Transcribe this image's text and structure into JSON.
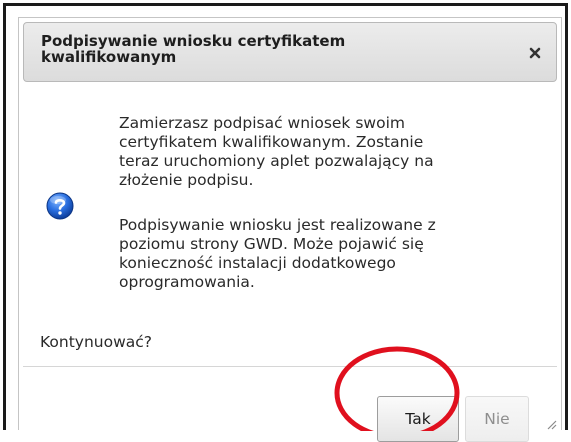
{
  "dialog": {
    "title": "Podpisywanie wniosku certyfikatem kwalifikowanym",
    "close_icon": "close-icon",
    "question_icon": "question-icon",
    "paragraph_1": "Zamierzasz podpisać wniosek swoim\ncertyfikatem kwalifikowanym. Zostanie\nteraz uruchomiony aplet pozwalający na\nzłożenie podpisu.",
    "paragraph_2": "Podpisywanie wniosku jest realizowane z\npoziomu strony GWD. Może pojawić się\nkonieczność instalacji dodatkowego\noprogramowania.",
    "prompt": "Kontynuować?",
    "buttons": {
      "yes_label": "Tak",
      "no_label": "Nie"
    }
  },
  "colors": {
    "highlight": "#e0101e",
    "question_icon_fill": "#1a5fd0",
    "titlebar": "#e3e3e3"
  }
}
